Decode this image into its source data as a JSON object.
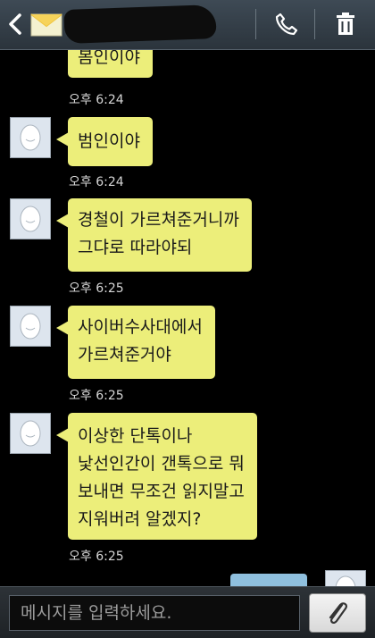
{
  "header": {
    "back_icon": "chevron-left-icon",
    "contact_icon": "envelope-icon",
    "contact_name_redacted": true,
    "call_icon": "phone-icon",
    "delete_icon": "trash-icon"
  },
  "messages": [
    {
      "sender": "other",
      "text": "봄인이야",
      "time": "오후 6:24",
      "partial": true
    },
    {
      "sender": "other",
      "text": "범인이야",
      "time": "오후 6:24"
    },
    {
      "sender": "other",
      "text": "경철이 가르쳐준거니까\n그댜로 따라야되",
      "time": "오후 6:25"
    },
    {
      "sender": "other",
      "text": "사이버수사대에서\n가르쳐준거야",
      "time": "오후 6:25"
    },
    {
      "sender": "other",
      "text": "이상한 단톡이나\n낯선인간이 갠톡으로 뭐\n보내면 무조건 읽지말고\n지워버려 알겠지?",
      "time": "오후 6:25"
    }
  ],
  "composer": {
    "placeholder": "메시지를 입력하세요.",
    "attach_icon": "paperclip-icon"
  },
  "colors": {
    "incoming_bubble": "#ecee7a",
    "outgoing_bubble": "#8fc0de",
    "background": "#000000"
  }
}
